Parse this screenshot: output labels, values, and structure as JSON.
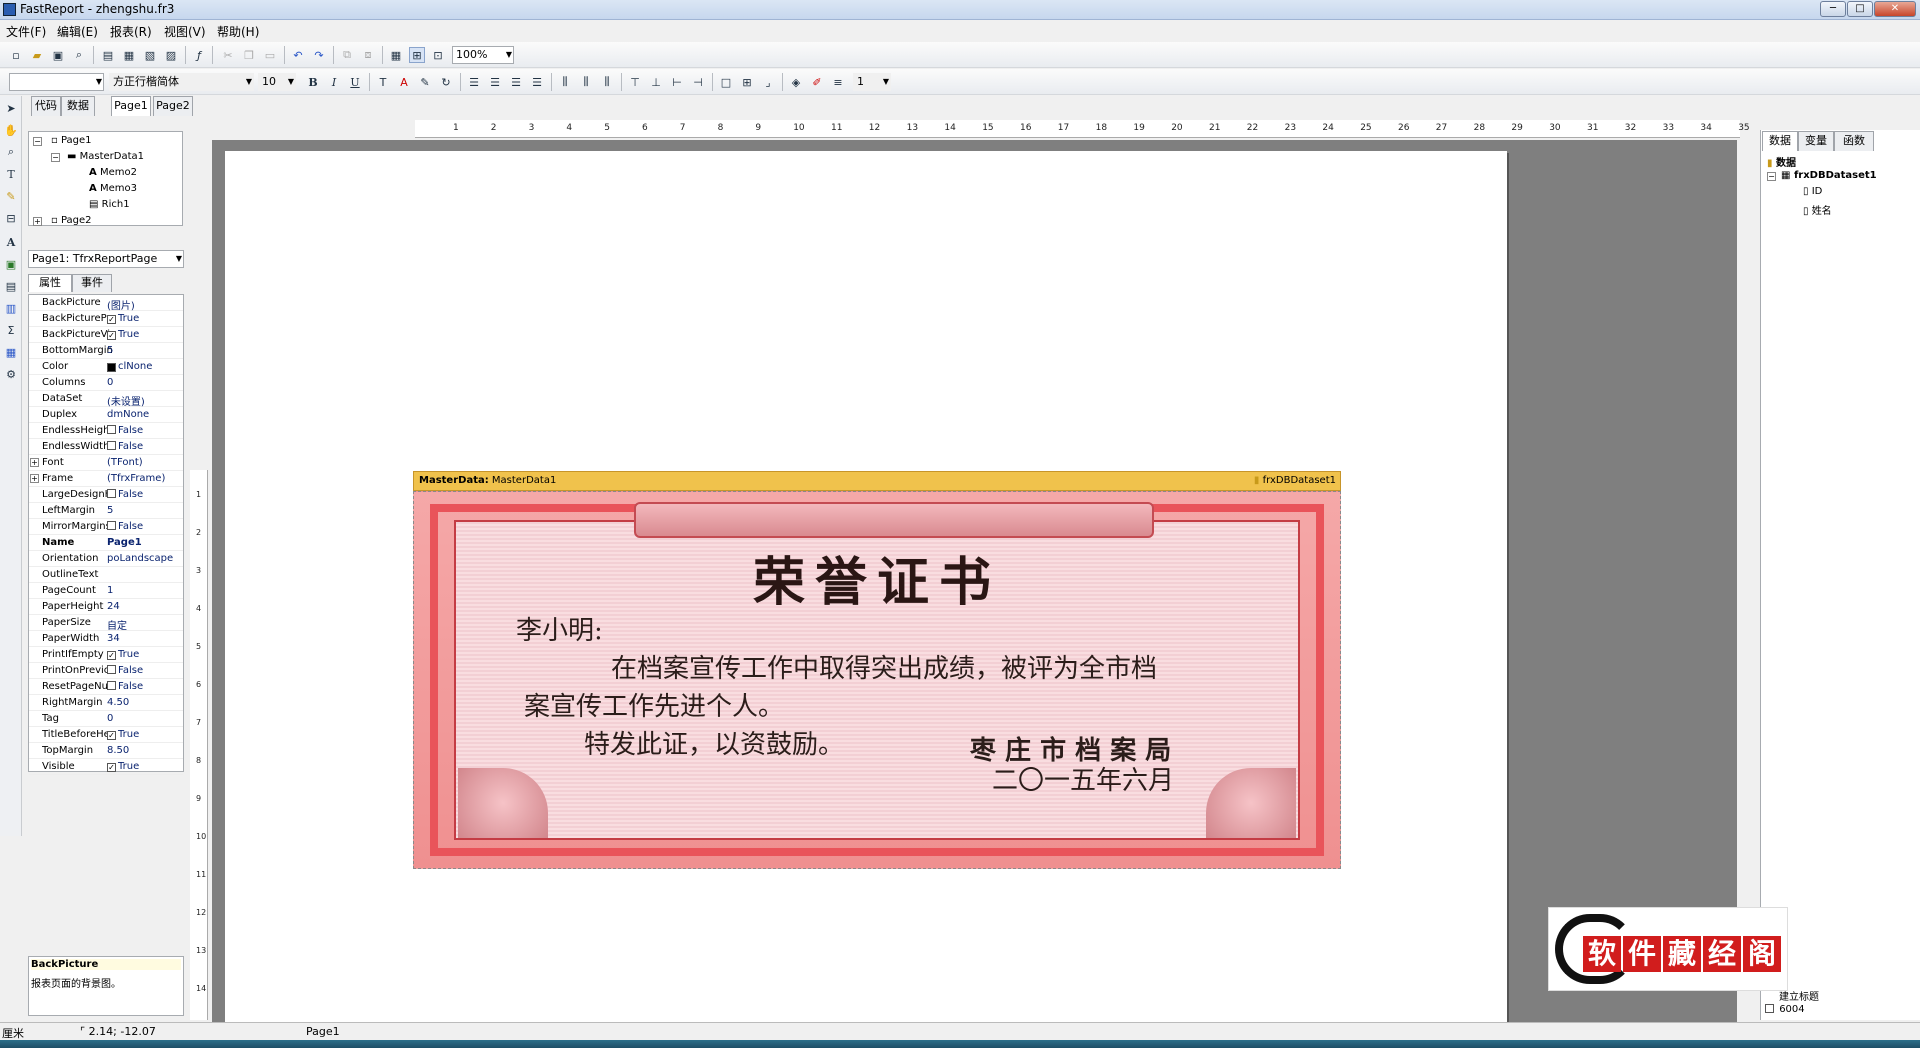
{
  "window": {
    "title": "FastReport - zhengshu.fr3",
    "min": "─",
    "max": "□",
    "close": "✕"
  },
  "menu": [
    "文件(F)",
    "编辑(E)",
    "报表(R)",
    "视图(V)",
    "帮助(H)"
  ],
  "toolbar": {
    "zoom": "100%",
    "font_name": "方正行楷简体",
    "font_size": "10",
    "line_width": "1",
    "bold": "B",
    "italic": "I",
    "underline": "U"
  },
  "tabs": {
    "code": "代码",
    "data": "数据",
    "page1": "Page1",
    "page2": "Page2"
  },
  "tree": {
    "page1": "Page1",
    "masterdata": "MasterData1",
    "memo2": "Memo2",
    "memo3": "Memo3",
    "rich1": "Rich1",
    "page2": "Page2"
  },
  "page_select": "Page1: TfrxReportPage",
  "prop_tabs": {
    "props": "属性",
    "events": "事件"
  },
  "properties": [
    {
      "name": "BackPicture",
      "value": "(图片)",
      "check": ""
    },
    {
      "name": "BackPicturePr",
      "value": "True",
      "check": "✓"
    },
    {
      "name": "BackPictureVi",
      "value": "True",
      "check": "✓"
    },
    {
      "name": "BottomMargin",
      "value": "5",
      "check": ""
    },
    {
      "name": "Color",
      "value": "clNone",
      "check": "■"
    },
    {
      "name": "Columns",
      "value": "0",
      "check": ""
    },
    {
      "name": "DataSet",
      "value": "(未设置)",
      "check": ""
    },
    {
      "name": "Duplex",
      "value": "dmNone",
      "check": ""
    },
    {
      "name": "EndlessHeigh",
      "value": "False",
      "check": " "
    },
    {
      "name": "EndlessWidth",
      "value": "False",
      "check": " "
    },
    {
      "name": "Font",
      "value": "(TFont)",
      "check": ""
    },
    {
      "name": "Frame",
      "value": "(TfrxFrame)",
      "check": ""
    },
    {
      "name": "LargeDesignH",
      "value": "False",
      "check": " "
    },
    {
      "name": "LeftMargin",
      "value": "5",
      "check": ""
    },
    {
      "name": "MirrorMargins",
      "value": "False",
      "check": " "
    },
    {
      "name": "Name",
      "value": "Page1",
      "check": ""
    },
    {
      "name": "Orientation",
      "value": "poLandscape",
      "check": ""
    },
    {
      "name": "OutlineText",
      "value": "",
      "check": ""
    },
    {
      "name": "PageCount",
      "value": "1",
      "check": ""
    },
    {
      "name": "PaperHeight",
      "value": "24",
      "check": ""
    },
    {
      "name": "PaperSize",
      "value": "自定",
      "check": ""
    },
    {
      "name": "PaperWidth",
      "value": "34",
      "check": ""
    },
    {
      "name": "PrintIfEmpty",
      "value": "True",
      "check": "✓"
    },
    {
      "name": "PrintOnPrevic",
      "value": "False",
      "check": " "
    },
    {
      "name": "ResetPageNu",
      "value": "False",
      "check": " "
    },
    {
      "name": "RightMargin",
      "value": "4.50",
      "check": ""
    },
    {
      "name": "Tag",
      "value": "0",
      "check": ""
    },
    {
      "name": "TitleBeforeHe",
      "value": "True",
      "check": "✓"
    },
    {
      "name": "TopMargin",
      "value": "8.50",
      "check": ""
    },
    {
      "name": "Visible",
      "value": "True",
      "check": "✓"
    }
  ],
  "prop_desc": {
    "title": "BackPicture",
    "text": "报表页面的背景图。"
  },
  "ruler_h": [
    "1",
    "2",
    "3",
    "4",
    "5",
    "6",
    "7",
    "8",
    "9",
    "10",
    "11",
    "12",
    "13",
    "14",
    "15",
    "16",
    "17",
    "18",
    "19",
    "20",
    "21",
    "22",
    "23",
    "24",
    "25",
    "26",
    "27",
    "28",
    "29",
    "30",
    "31",
    "32",
    "33",
    "34",
    "35"
  ],
  "ruler_v": [
    "1",
    "2",
    "3",
    "4",
    "5",
    "6",
    "7",
    "8",
    "9",
    "10",
    "11",
    "12",
    "13",
    "14"
  ],
  "band": {
    "label": "MasterData:",
    "name": "MasterData1",
    "dataset": "frxDBDataset1"
  },
  "certificate": {
    "title": "荣誉证书",
    "name": "李小明:",
    "line1": "在档案宣传工作中取得突出成绩，被评为全市档",
    "line2": "案宣传工作先进个人。",
    "line3": "特发此证，以资鼓励。",
    "org": "枣 庄 市 档 案 局",
    "date": "二〇一五年六月"
  },
  "right_tabs": {
    "data": "数据",
    "vars": "变量",
    "funcs": "函数"
  },
  "datatree": {
    "root": "数据",
    "dataset": "frxDBDataset1",
    "field1": "ID",
    "field2": "姓名"
  },
  "right_bottom": {
    "item1": "建立标题",
    "item2": "6004"
  },
  "statusbar": {
    "unit": "厘米",
    "coords": "2.14; -12.07",
    "page": "Page1"
  },
  "watermark": {
    "chars": [
      "软",
      "件",
      "藏",
      "经",
      "阁"
    ]
  }
}
